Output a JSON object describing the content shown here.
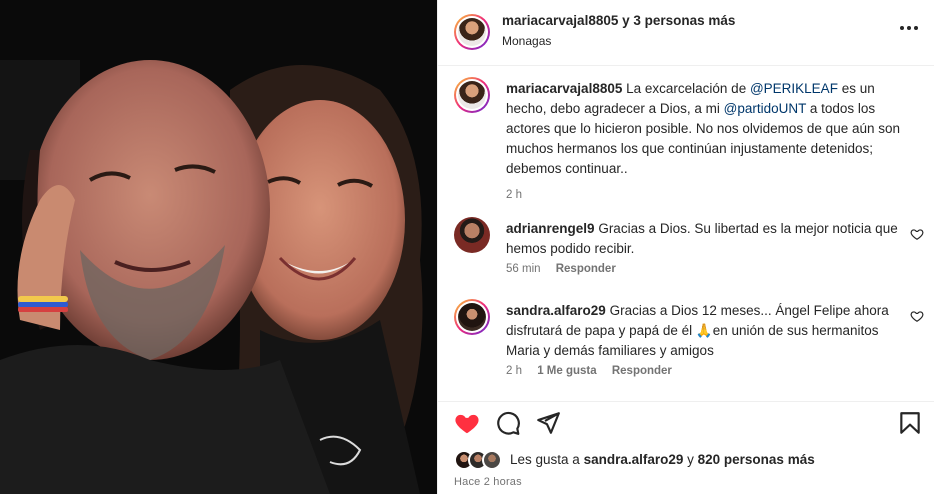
{
  "header": {
    "username": "mariacarvajal8805",
    "coauthors": " y 3 personas más",
    "location": "Monagas",
    "more_icon": "more-horizontal-icon"
  },
  "caption": {
    "username": "mariacarvajal8805",
    "text_1": "La excarcelación de ",
    "mention_1": "@PERIKLEAF",
    "text_2": " es un hecho, debo agradecer a Dios, a mi ",
    "mention_2": "@partidoUNT",
    "text_3": " a todos los actores que lo hicieron posible. No nos olvidemos de que aún son muchos hermanos los que continúan injustamente detenidos; debemos continuar..",
    "time": "2 h"
  },
  "comments": [
    {
      "username": "adrianrengel9",
      "text": "Gracias a Dios. Su libertad es la mejor noticia que hemos podido recibir.",
      "time": "56 min",
      "likes": "",
      "reply": "Responder"
    },
    {
      "username": "sandra.alfaro29",
      "text": "Gracias a Dios 12 meses... Ángel Felipe ahora disfrutará de papa y papá de él 🙏en unión de sus hermanitos Maria y demás familiares y amigos",
      "time": "2 h",
      "likes": "1 Me gusta",
      "reply": "Responder"
    }
  ],
  "actions": {
    "icons": [
      "heart-filled-icon",
      "comment-icon",
      "share-icon",
      "bookmark-icon"
    ],
    "like_color": "#ff3040"
  },
  "likes": {
    "prefix": "Les gusta a ",
    "user": "sandra.alfaro29",
    "middle": " y ",
    "count": "820 personas más"
  },
  "posted": "Hace 2 horas"
}
